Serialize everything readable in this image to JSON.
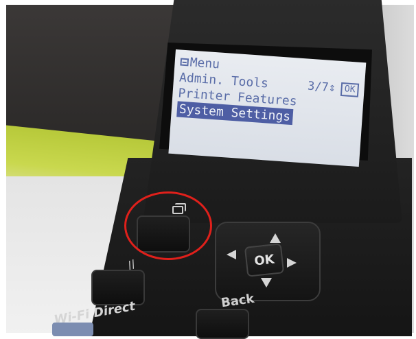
{
  "lcd": {
    "menu_title": "Menu",
    "page_indicator": "3/7",
    "scroll_glyph": "⇕",
    "ok_badge": "OK",
    "items": [
      {
        "label": "Admin. Tools"
      },
      {
        "label": "Printer Features"
      },
      {
        "label": "System Settings",
        "selected": true
      }
    ]
  },
  "buttons": {
    "ok_label": "OK",
    "back_label": "Back",
    "wifi_label": "Wi-Fi Direct",
    "clear_glyph": "//"
  },
  "colors": {
    "highlight": "#e0201b",
    "lcd_text": "#5a6da8",
    "lcd_bg": "#e3e7ee"
  }
}
